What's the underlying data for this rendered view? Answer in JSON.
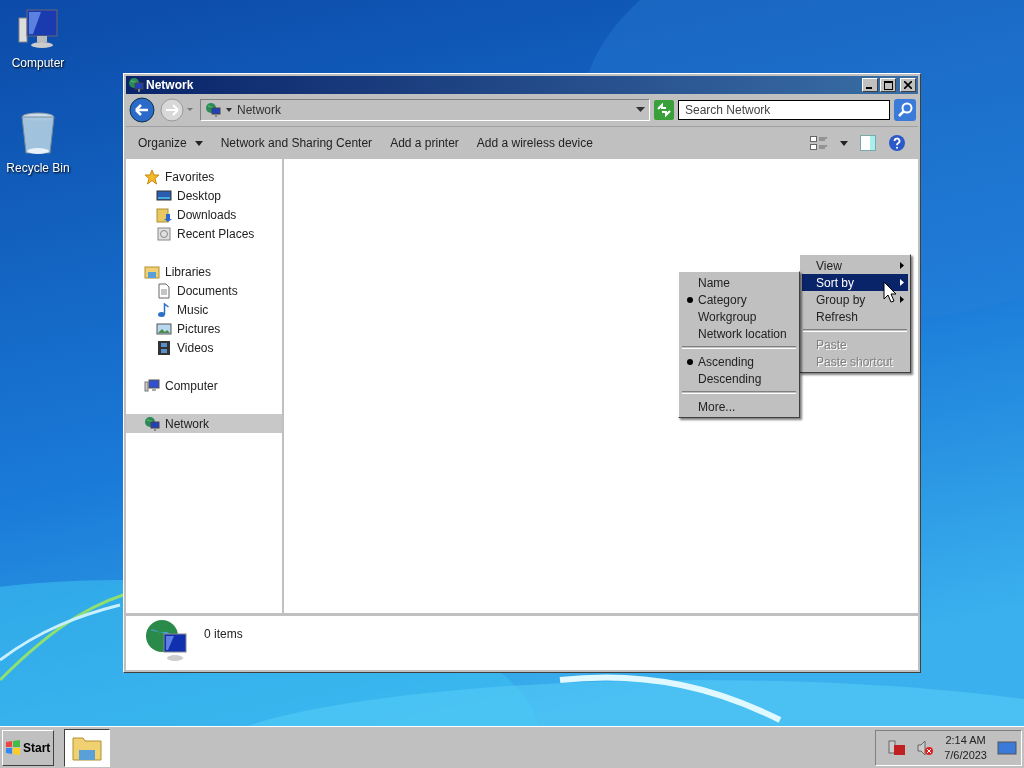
{
  "desktop_icons": [
    {
      "label": "Computer",
      "kind": "computer"
    },
    {
      "label": "Recycle Bin",
      "kind": "recycle"
    }
  ],
  "window": {
    "title": "Network",
    "address": {
      "path": "Network"
    },
    "search": {
      "placeholder": "Search Network"
    },
    "command_bar": [
      {
        "label": "Organize",
        "kind": "menu"
      },
      {
        "label": "Network and Sharing Center",
        "kind": "link"
      },
      {
        "label": "Add a printer",
        "kind": "link"
      },
      {
        "label": "Add a wireless device",
        "kind": "link"
      }
    ],
    "nav": [
      {
        "label": "Favorites",
        "kind": "star",
        "selected": false,
        "children": [
          {
            "label": "Desktop",
            "kind": "desktop",
            "selected": false
          },
          {
            "label": "Downloads",
            "kind": "downloads",
            "selected": false
          },
          {
            "label": "Recent Places",
            "kind": "recent",
            "selected": false
          }
        ]
      },
      {
        "label": "Libraries",
        "kind": "library",
        "selected": false,
        "children": [
          {
            "label": "Documents",
            "kind": "document",
            "selected": false
          },
          {
            "label": "Music",
            "kind": "music",
            "selected": false
          },
          {
            "label": "Pictures",
            "kind": "pictures",
            "selected": false
          },
          {
            "label": "Videos",
            "kind": "videos",
            "selected": false
          }
        ]
      },
      {
        "label": "Computer",
        "kind": "computer",
        "selected": false
      },
      {
        "label": "Network",
        "kind": "network",
        "selected": true
      }
    ],
    "status": {
      "count": "0 items"
    }
  },
  "context_menu": [
    {
      "kind": "item",
      "label": "View",
      "submenu": true,
      "selected": false,
      "disabled": false
    },
    {
      "kind": "item",
      "label": "Sort by",
      "submenu": true,
      "selected": true,
      "disabled": false
    },
    {
      "kind": "item",
      "label": "Group by",
      "submenu": true,
      "selected": false,
      "disabled": false
    },
    {
      "kind": "item",
      "label": "Refresh",
      "submenu": false,
      "selected": false,
      "disabled": false
    },
    {
      "kind": "separator"
    },
    {
      "kind": "item",
      "label": "Paste",
      "submenu": false,
      "selected": false,
      "disabled": true
    },
    {
      "kind": "item",
      "label": "Paste shortcut",
      "submenu": false,
      "selected": false,
      "disabled": true
    }
  ],
  "sort_menu": [
    {
      "kind": "item",
      "label": "Name",
      "checked": false
    },
    {
      "kind": "item",
      "label": "Category",
      "checked": true
    },
    {
      "kind": "item",
      "label": "Workgroup",
      "checked": false
    },
    {
      "kind": "item",
      "label": "Network location",
      "checked": false
    },
    {
      "kind": "separator"
    },
    {
      "kind": "item",
      "label": "Ascending",
      "checked": true
    },
    {
      "kind": "item",
      "label": "Descending",
      "checked": false
    },
    {
      "kind": "separator"
    },
    {
      "kind": "item",
      "label": "More...",
      "checked": false
    }
  ],
  "taskbar": {
    "start": "Start",
    "time": "2:14 AM",
    "date": "7/6/2023"
  }
}
